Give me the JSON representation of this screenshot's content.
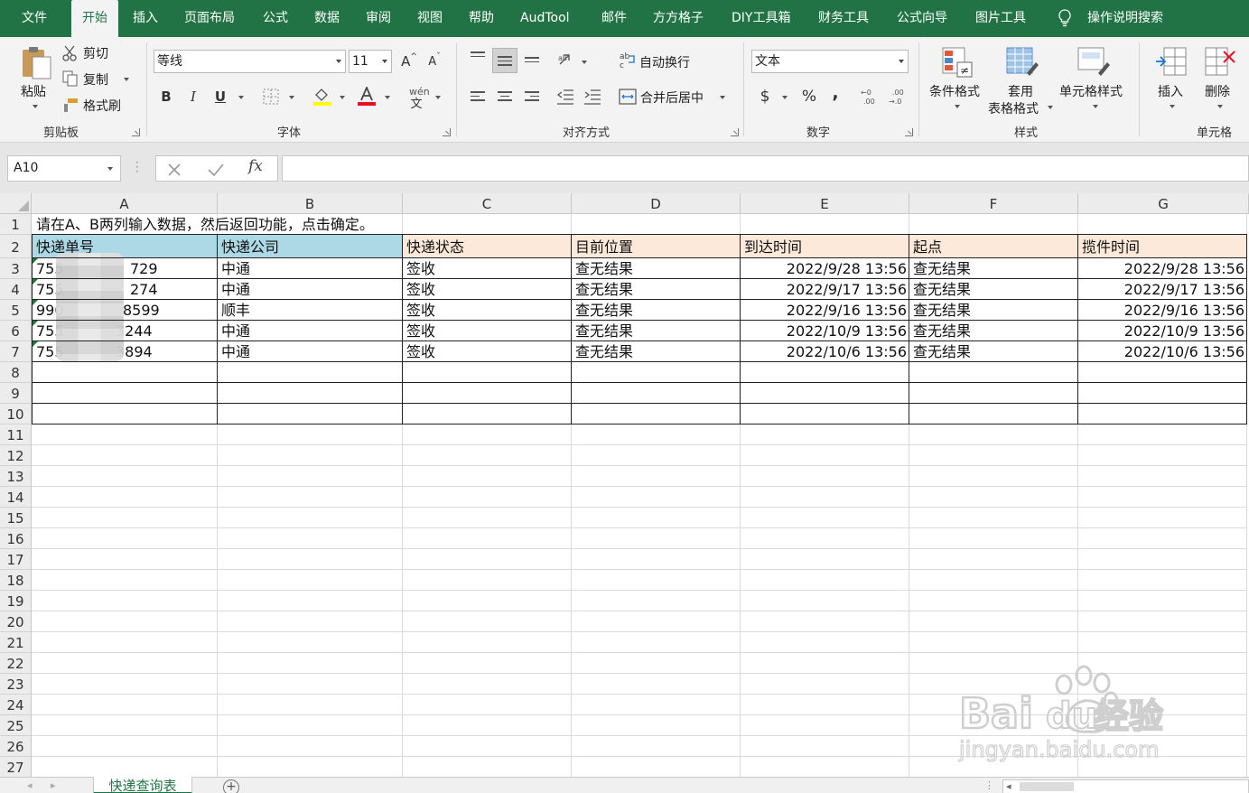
{
  "menu": {
    "tabs": [
      "文件",
      "开始",
      "插入",
      "页面布局",
      "公式",
      "数据",
      "审阅",
      "视图",
      "帮助",
      "AudTool",
      "邮件",
      "方方格子",
      "DIY工具箱",
      "财务工具",
      "公式向导",
      "图片工具"
    ],
    "active": "开始",
    "tell_me": "操作说明搜索"
  },
  "ribbon": {
    "clipboard": {
      "paste": "粘贴",
      "cut": "剪切",
      "copy": "复制",
      "format_painter": "格式刷",
      "label": "剪贴板"
    },
    "font": {
      "name": "等线",
      "size": "11",
      "bold": "B",
      "italic": "I",
      "underline": "U",
      "label": "字体",
      "wen": "wén"
    },
    "alignment": {
      "wrap": "自动换行",
      "merge": "合并后居中",
      "label": "对齐方式"
    },
    "number": {
      "format": "文本",
      "currency": "$",
      "percent": "%",
      "comma": ",",
      "label": "数字"
    },
    "styles": {
      "conditional": "条件格式",
      "table_1": "套用",
      "table_2": "表格格式",
      "cell_styles": "单元格样式",
      "label": "样式"
    },
    "cells": {
      "insert": "插入",
      "delete": "删除",
      "label": "单元格"
    }
  },
  "formula_bar": {
    "name_box": "A10",
    "fx": "fx",
    "value": ""
  },
  "grid": {
    "columns": [
      "A",
      "B",
      "C",
      "D",
      "E",
      "F",
      "G"
    ],
    "rows": [
      "1",
      "2",
      "3",
      "4",
      "5",
      "6",
      "7",
      "8",
      "9",
      "10",
      "11",
      "12",
      "13",
      "14",
      "15",
      "16",
      "17",
      "18",
      "19",
      "20",
      "21",
      "22",
      "23",
      "24",
      "25",
      "26",
      "27"
    ],
    "note": "请在A、B两列输入数据，然后返回功能，点击确定。",
    "headers": [
      "快递单号",
      "快递公司",
      "快递状态",
      "目前位置",
      "到达时间",
      "起点",
      "揽件时间"
    ],
    "data": [
      [
        "755",
        "729",
        "中通",
        "签收",
        "查无结果",
        "2022/9/28 13:56",
        "查无结果",
        "2022/9/28 13:56"
      ],
      [
        "755",
        "274",
        "中通",
        "签收",
        "查无结果",
        "2022/9/17 13:56",
        "查无结果",
        "2022/9/17 13:56"
      ],
      [
        "990",
        "8599",
        "顺丰",
        "签收",
        "查无结果",
        "2022/9/16 13:56",
        "查无结果",
        "2022/9/16 13:56"
      ],
      [
        "755",
        "3244",
        "中通",
        "签收",
        "查无结果",
        "2022/10/9 13:56",
        "查无结果",
        "2022/10/9 13:56"
      ],
      [
        "755",
        "3894",
        "中通",
        "签收",
        "查无结果",
        "2022/10/6 13:56",
        "查无结果",
        "2022/10/6 13:56"
      ]
    ]
  },
  "sheets": {
    "active": "快递查询表",
    "add": "+"
  },
  "watermark": {
    "brand": "Bai",
    "brand2": "du",
    "suffix": "经验",
    "url": "jingyan.baidu.com"
  },
  "colors": {
    "excel_green": "#217346",
    "header_blue": "#add8e6",
    "header_peach": "#fde9d9"
  }
}
